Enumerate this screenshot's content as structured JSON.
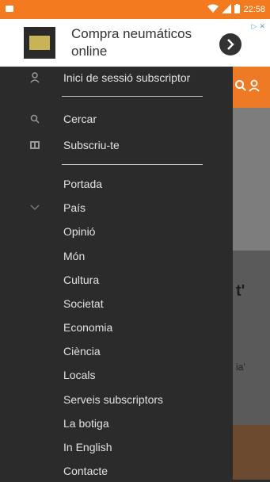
{
  "status_bar": {
    "time": "22:58",
    "left_icon": "notification-icon",
    "right_icons": [
      "wifi-icon",
      "signal-icon",
      "battery-icon"
    ]
  },
  "ad": {
    "text": "Compra neumáticos online",
    "next_icon": "chevron-right-icon",
    "corner_icons": [
      "ad-choices-icon",
      "ad-close-icon"
    ]
  },
  "drawer": {
    "account": {
      "icon": "user-icon",
      "label": "Inici de sessió subscriptor"
    },
    "tools": [
      {
        "icon": "search-icon",
        "label": "Cercar"
      },
      {
        "icon": "newspaper-icon",
        "label": "Subscriu-te"
      }
    ],
    "sections": [
      {
        "label": "Portada"
      },
      {
        "label": "País",
        "has_chevron": true
      },
      {
        "label": "Opinió"
      },
      {
        "label": "Món"
      },
      {
        "label": "Cultura"
      },
      {
        "label": "Societat"
      },
      {
        "label": "Economia"
      },
      {
        "label": "Ciència"
      },
      {
        "label": "Locals"
      },
      {
        "label": "Serveis subscriptors"
      },
      {
        "label": "La botiga"
      },
      {
        "label": "In English"
      },
      {
        "label": "Contacte"
      }
    ]
  },
  "background_page": {
    "header_icons": [
      "search-icon",
      "user-icon"
    ],
    "headline_fragment": "t'",
    "text_fragment": "ia'"
  },
  "colors": {
    "accent": "#f47a20",
    "drawer_bg": "#2b2b2b",
    "menu_text": "#e2e2e2",
    "divider": "#bdbdbd"
  }
}
